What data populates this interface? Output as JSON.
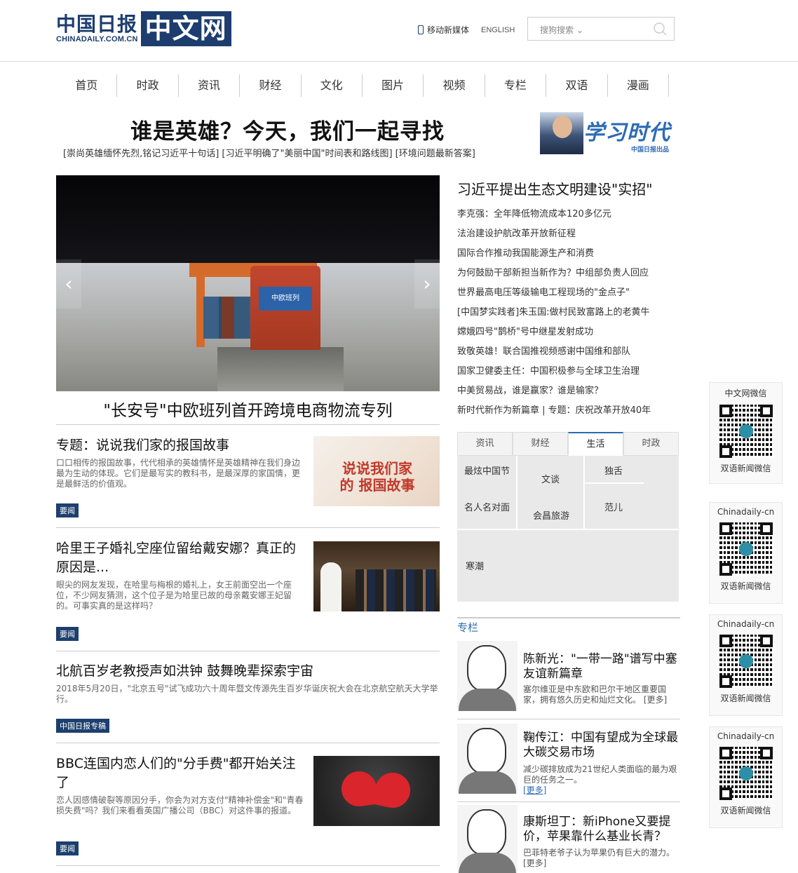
{
  "header": {
    "logo_cn": "中国日报",
    "logo_en": "CHINADAILY.COM.CN",
    "logo_box": "中文网",
    "mobile_link": "移动新媒体",
    "english_link": "ENGLISH",
    "search_dropdown": "搜狗搜索 ⌄"
  },
  "nav": [
    "首页",
    "时政",
    "资讯",
    "财经",
    "文化",
    "图片",
    "视频",
    "专栏",
    "双语",
    "漫画"
  ],
  "banner": {
    "headline": "谁是英雄？今天，我们一起寻找",
    "sublinks": "[崇尚英雄缅怀先烈,铭记习近平十句话] [习近平明确了\"美丽中国\"时间表和路线图] [环境问题最新答案]",
    "xuexi_title": "学习时代",
    "xuexi_sub": "中国日报出品"
  },
  "carousel": {
    "caption": "\"长安号\"中欧班列首开跨境电商物流专列",
    "sign": "中欧班列",
    "prev_arrow": "‹",
    "next_arrow": "›"
  },
  "topnews": {
    "title": "习近平提出生态文明建设\"实招\"",
    "items": [
      "李克强：全年降低物流成本120多亿元",
      "法治建设护航改革开放新征程",
      "国际合作推动我国能源生产和消费",
      "为何鼓励干部新担当新作为？中组部负责人回应",
      "世界最高电压等级输电工程现场的\"金点子\"",
      "[中国梦实践者]朱玉国:做村民致富路上的老黄牛",
      "嫦娥四号\"鹊桥\"号中继星发射成功",
      "致敬英雄！联合国推视频感谢中国维和部队",
      "国家卫健委主任：中国积极参与全球卫生治理",
      "中美贸易战，谁是赢家？谁是输家？",
      "新时代新作为新篇章 | 专题：庆祝改革开放40年"
    ]
  },
  "tabs": {
    "labels": [
      "资讯",
      "财经",
      "生活",
      "时政"
    ],
    "active": "生活",
    "cells": {
      "c1": "最炫中国节",
      "c2": "文谈",
      "c3": "独舌",
      "c4": "名人名对面",
      "c5": "会昌旅游",
      "c6": "范儿",
      "c7": "寒潮"
    }
  },
  "articles": [
    {
      "title": "专题：说说我们家的报国故事",
      "desc": "口口相传的报国故事，代代相承的英雄情怀是英雄精神在我们身边最为生动的体现。它们是最写实的教科书，是最深厚的家国情，更是最鲜活的价值观。",
      "tag": "要闻",
      "img_text": "说说我们家的 报国故事"
    },
    {
      "title": "哈里王子婚礼空座位留给戴安娜？真正的原因是...",
      "desc": "眼尖的网友发现，在哈里与梅根的婚礼上，女王前面空出一个座位，不少网友猜测，这个位子是为哈里已故的母亲戴安娜王妃留的。可事实真的是这样吗？",
      "tag": "要闻"
    },
    {
      "title": "北航百岁老教授声如洪钟 鼓舞晚辈探索宇宙",
      "desc": "2018年5月20日，\"北京五号\"试飞成功六十周年暨文传源先生百岁华诞庆祝大会在北京航空航天大学举行。",
      "tag": "中国日报专稿"
    },
    {
      "title": "BBC连国内恋人们的\"分手费\"都开始关注了",
      "desc": "恋人因感情破裂等原因分手，你会为对方支付\"精神补偿金\"和\"青春损失费\"吗？我们来看看英国广播公司（BBC）对这件事的报道。",
      "tag": "要闻"
    }
  ],
  "zhuanlan": {
    "heading": "专栏",
    "items": [
      {
        "title": "陈新光：\"一带一路\"谱写中塞友谊新篇章",
        "desc": "塞尔维亚是中东欧和巴尔干地区重要国家，拥有悠久历史和灿烂文化。",
        "more": "[更多]"
      },
      {
        "title": "鞠传江：中国有望成为全球最大碳交易市场",
        "desc": "减少碳排放成为21世纪人类面临的最为艰巨的任务之一。",
        "more": "[更多]"
      },
      {
        "title": "康斯坦丁：新iPhone又要提价，苹果靠什么基业长青？",
        "desc": "巴菲特老爷子认为苹果仍有巨大的潜力。",
        "more": "[更多]"
      }
    ]
  },
  "qr": [
    {
      "label": "中文网微信",
      "caption": "双语新闻微信"
    },
    {
      "label": "Chinadaily-cn",
      "caption": "双语新闻微信"
    },
    {
      "label": "Chinadaily-cn",
      "caption": "双语新闻微信"
    },
    {
      "label": "Chinadaily-cn",
      "caption": "双语新闻微信"
    }
  ]
}
